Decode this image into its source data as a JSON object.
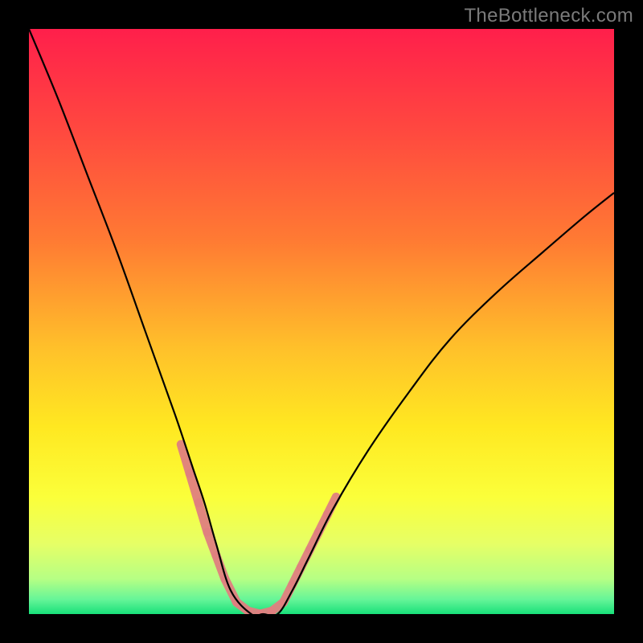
{
  "watermark": {
    "text": "TheBottleneck.com"
  },
  "gradient": {
    "stops": [
      {
        "offset": 0.0,
        "color": "#ff1f4b"
      },
      {
        "offset": 0.18,
        "color": "#ff4a3f"
      },
      {
        "offset": 0.36,
        "color": "#ff7a33"
      },
      {
        "offset": 0.55,
        "color": "#ffc22a"
      },
      {
        "offset": 0.68,
        "color": "#ffe821"
      },
      {
        "offset": 0.8,
        "color": "#fbff3a"
      },
      {
        "offset": 0.88,
        "color": "#e6ff66"
      },
      {
        "offset": 0.94,
        "color": "#b6ff84"
      },
      {
        "offset": 0.975,
        "color": "#66f598"
      },
      {
        "offset": 1.0,
        "color": "#18e07a"
      }
    ]
  },
  "chart_data": {
    "type": "line",
    "title": "",
    "xlabel": "",
    "ylabel": "",
    "xlim": [
      0,
      100
    ],
    "ylim": [
      0,
      100
    ],
    "series": [
      {
        "name": "bottleneck-curve",
        "x": [
          0,
          5,
          10,
          15,
          20,
          25,
          28,
          30,
          32,
          34.5,
          38,
          40,
          42.5,
          45,
          48,
          52,
          58,
          65,
          72,
          80,
          88,
          95,
          100
        ],
        "y": [
          100,
          88,
          75,
          62,
          48,
          34,
          25,
          19,
          12,
          4,
          0,
          0,
          0,
          4,
          10,
          18,
          28,
          38,
          47,
          55,
          62,
          68,
          72
        ],
        "color": "#000000",
        "width": 2.2
      }
    ],
    "highlight_segments": {
      "name": "near-optimum-markers",
      "color": "#e08080",
      "width": 11,
      "x": [
        26,
        27.5,
        29,
        30.5,
        32,
        33.5,
        35.5,
        37.5,
        39.5,
        41.5,
        43.5,
        45,
        46.5,
        48,
        49.5,
        51,
        52.5
      ],
      "y": [
        29,
        24,
        19,
        14,
        10,
        6,
        2,
        0.5,
        0,
        0.5,
        2,
        5,
        8,
        11,
        14,
        17,
        20
      ]
    }
  }
}
